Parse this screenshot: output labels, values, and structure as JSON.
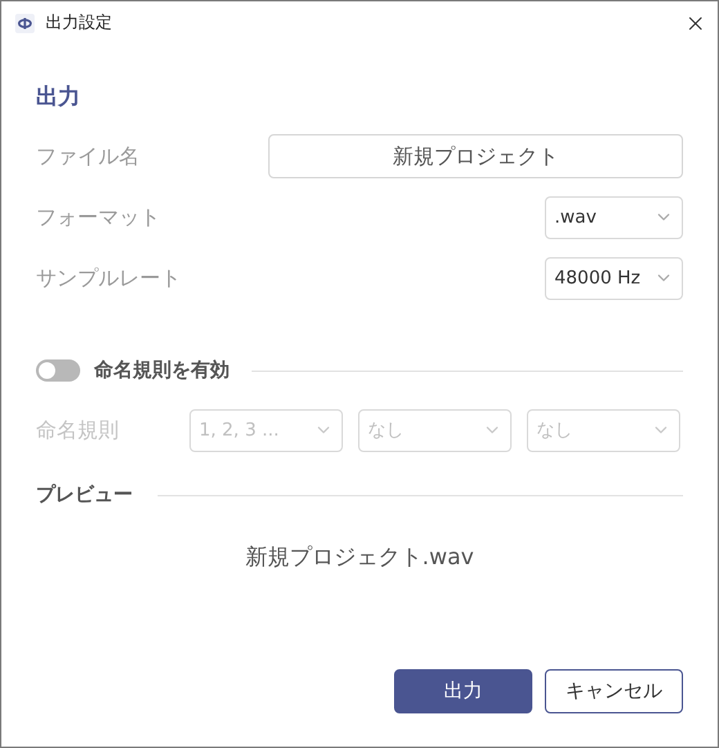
{
  "window": {
    "title": "出力設定"
  },
  "section": {
    "title": "出力"
  },
  "fields": [
    {
      "kind": "text",
      "label": "ファイル名",
      "value": "新規プロジェクト"
    },
    {
      "kind": "select",
      "label": "フォーマット",
      "value": ".wav"
    },
    {
      "kind": "select",
      "label": "サンプルレート",
      "value": "48000 Hz"
    }
  ],
  "naming_toggle": {
    "label": "命名規則を有効",
    "on": false
  },
  "naming": {
    "label": "命名規則",
    "disabled": true,
    "selects": [
      {
        "value": "1, 2, 3 ..."
      },
      {
        "value": "なし"
      },
      {
        "value": "なし"
      }
    ]
  },
  "preview": {
    "title": "プレビュー",
    "text": "新規プロジェクト.wav"
  },
  "buttons": [
    {
      "kind": "primary",
      "label": "出力"
    },
    {
      "kind": "secondary",
      "label": "キャンセル"
    }
  ]
}
